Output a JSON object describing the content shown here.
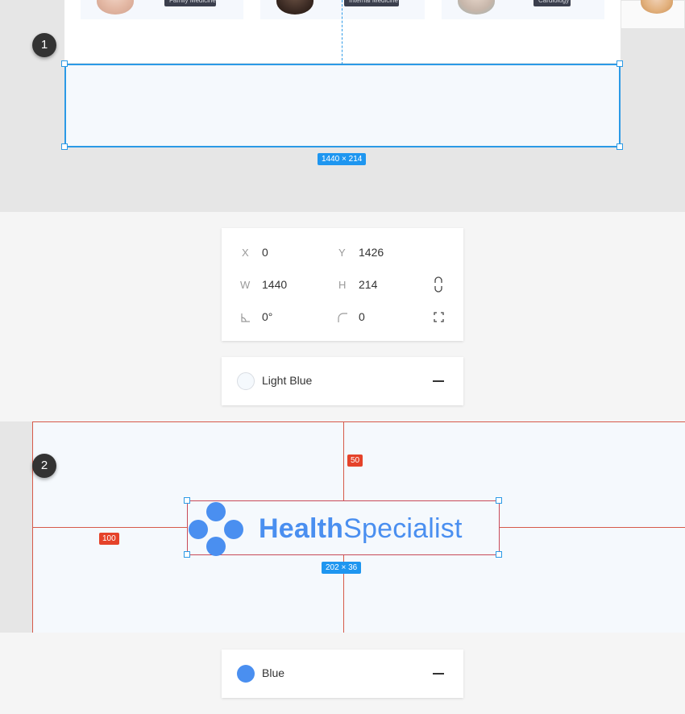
{
  "preview": {
    "cards": [
      {
        "tag": "Family Medicine"
      },
      {
        "tag": "Internal Medicine"
      },
      {
        "tag": "Cardiology"
      }
    ]
  },
  "steps": [
    "1",
    "2"
  ],
  "selection1": {
    "dimensions": "1440 × 214"
  },
  "properties": {
    "x_label": "X",
    "x_value": "0",
    "y_label": "Y",
    "y_value": "1426",
    "w_label": "W",
    "w_value": "1440",
    "h_label": "H",
    "h_value": "214",
    "rotation_value": "0°",
    "radius_value": "0"
  },
  "fill1": {
    "name": "Light Blue",
    "color": "#f5f9fd"
  },
  "section2": {
    "top_spacing": "50",
    "left_spacing": "100",
    "logo_dimensions": "202 × 36",
    "logo_bold": "Health",
    "logo_regular": "Specialist",
    "logo_color": "#4a8ff0"
  },
  "fill2": {
    "name": "Blue",
    "color": "#4a8ff0"
  },
  "icons": {
    "constrain": "link-proportions-icon",
    "rotation": "rotation-icon",
    "radius": "corner-radius-icon",
    "independent_corners": "independent-corners-icon",
    "remove_fill": "minus-icon"
  }
}
